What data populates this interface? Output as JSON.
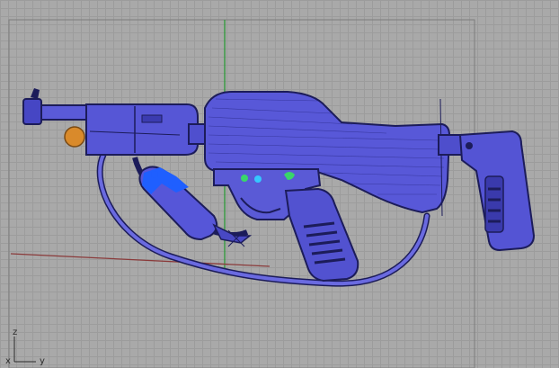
{
  "viewport": {
    "type": "3D modeling viewport (wireframe shaded)",
    "colors": {
      "background": "#a9a9a9",
      "grid": "#9c9c9c",
      "x_axis": "#8a3a3a",
      "y_axis": "#2e9a3a",
      "model_fill": "#5555d4",
      "model_dark": "#1c1c5a",
      "selected": "#1f5fff",
      "accent_orange": "#d98a2b",
      "accent_green": "#39d66a",
      "accent_cyan": "#35c8ff"
    }
  },
  "axis_gizmo": {
    "z_label": "z",
    "x_label": "x",
    "y_label": "y"
  },
  "model": {
    "object": "rifle",
    "icons": [
      "trigger-guard-icon",
      "magazine-icon",
      "stock-icon",
      "sling-icon"
    ]
  }
}
